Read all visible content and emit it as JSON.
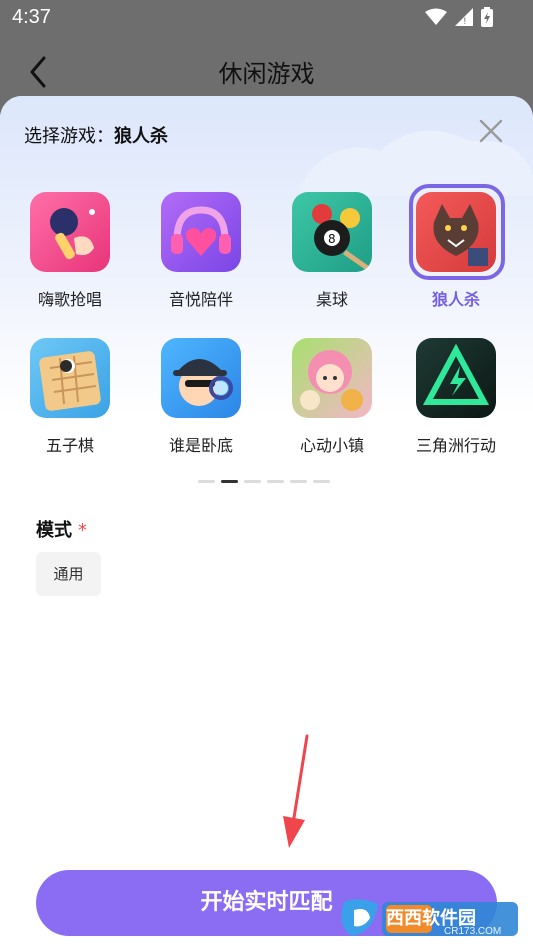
{
  "status_bar": {
    "time": "4:37"
  },
  "header": {
    "title": "休闲游戏"
  },
  "sheet": {
    "title_prefix": "选择游戏：",
    "selected_game": "狼人杀"
  },
  "games": [
    {
      "label": "嗨歌抢唱",
      "icon": "microphone-icon",
      "selected": false
    },
    {
      "label": "音悦陪伴",
      "icon": "headphones-heart-icon",
      "selected": false
    },
    {
      "label": "桌球",
      "icon": "billiards-icon",
      "selected": false
    },
    {
      "label": "狼人杀",
      "icon": "werewolf-icon",
      "selected": true
    },
    {
      "label": "五子棋",
      "icon": "gomoku-board-icon",
      "selected": false
    },
    {
      "label": "谁是卧底",
      "icon": "spy-detective-icon",
      "selected": false
    },
    {
      "label": "心动小镇",
      "icon": "town-girl-icon",
      "selected": false
    },
    {
      "label": "三角洲行动",
      "icon": "delta-force-icon",
      "selected": false
    }
  ],
  "pager": {
    "count": 6,
    "active_index": 1
  },
  "mode": {
    "title": "模式",
    "required_mark": "*",
    "option": "通用"
  },
  "start_button": {
    "label": "开始实时匹配"
  },
  "watermark": {
    "text": "西西软件园",
    "sub": "CR173.COM"
  },
  "colors": {
    "accent": "#8a6df3",
    "selected_ring": "#7b66e6",
    "required": "#f04a4a"
  }
}
